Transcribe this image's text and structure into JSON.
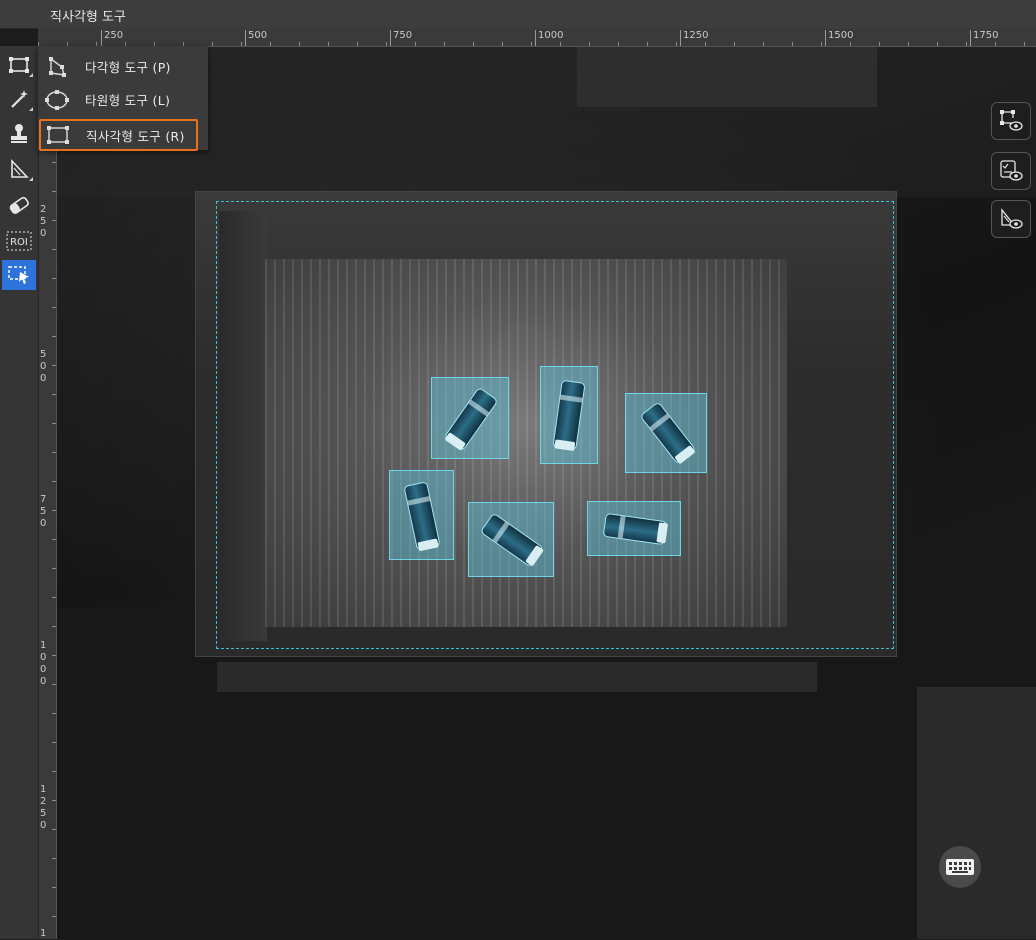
{
  "window": {
    "title": "직사각형 도구"
  },
  "ruler": {
    "top_labels": [
      "250",
      "500",
      "750",
      "1000",
      "1250",
      "1500",
      "1750"
    ],
    "left_labels": [
      "2\n5\n0",
      "5\n0\n0",
      "7\n5\n0",
      "1\n0\n0\n0",
      "1\n2\n5\n0",
      "1"
    ]
  },
  "toolbar": {
    "tools": [
      {
        "name": "rectangle-tool",
        "icon": "rectangle-select-icon"
      },
      {
        "name": "magic-wand-tool",
        "icon": "magic-wand-icon"
      },
      {
        "name": "stamp-tool",
        "icon": "stamp-icon"
      },
      {
        "name": "polygon-fill-tool",
        "icon": "polygon-fill-icon"
      },
      {
        "name": "eraser-tool",
        "icon": "eraser-icon"
      },
      {
        "name": "roi-tool",
        "icon": "roi-icon",
        "label": "ROI"
      },
      {
        "name": "select-tool",
        "icon": "select-arrow-icon",
        "active": true
      }
    ]
  },
  "flyout": {
    "items": [
      {
        "label": "다각형 도구 (P)",
        "icon": "polygon-icon"
      },
      {
        "label": "타원형 도구 (L)",
        "icon": "ellipse-icon"
      },
      {
        "label": "직사각형 도구 (R)",
        "icon": "rectangle-icon",
        "selected": true
      }
    ]
  },
  "annotations": {
    "label_count": 6
  },
  "colors": {
    "accent_blue": "#2d73d9",
    "selection_orange": "#e8701e",
    "roi_cyan": "#38c2cf",
    "label_fill": "#60c6de"
  },
  "side_buttons": [
    "shape-visibility-icon",
    "label-list-visibility-icon",
    "mask-visibility-icon"
  ],
  "keyboard_button": "keyboard-icon"
}
